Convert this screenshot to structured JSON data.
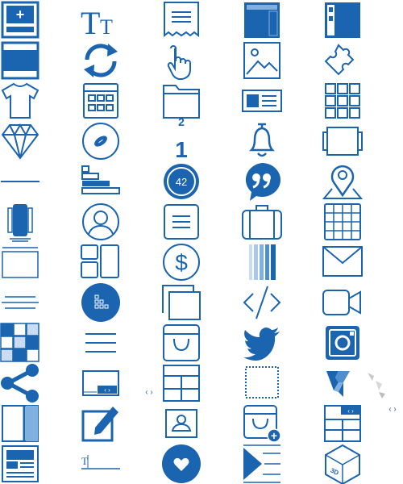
{
  "colors": {
    "primary": "#1a64b0",
    "light": "#7fb0e0",
    "pale": "#c9dcf1",
    "grey": "#c8c8c8",
    "white": "#ffffff"
  },
  "icons": {
    "add_block": {
      "name": "add-block-icon",
      "glyph": "+"
    },
    "typography": {
      "name": "typography-icon",
      "glyph_large": "T",
      "glyph_small": "T"
    },
    "receipt": {
      "name": "receipt-icon"
    },
    "header_layout": {
      "name": "header-layout-icon"
    },
    "sidebar_layout": {
      "name": "sidebar-layout-icon"
    },
    "banner": {
      "name": "banner-icon"
    },
    "refresh": {
      "name": "refresh-icon"
    },
    "tap": {
      "name": "tap-gesture-icon"
    },
    "image": {
      "name": "image-icon"
    },
    "puzzle": {
      "name": "puzzle-piece-icon"
    },
    "shirt": {
      "name": "tshirt-icon"
    },
    "calendar": {
      "name": "calendar-icon"
    },
    "folder": {
      "name": "folder-icon"
    },
    "media_text": {
      "name": "media-text-icon"
    },
    "grid_3x3": {
      "name": "grid-3x3-icon"
    },
    "diamond": {
      "name": "diamond-icon"
    },
    "football": {
      "name": "football-icon"
    },
    "counter": {
      "name": "counter-icon",
      "top": "2",
      "bottom": "1"
    },
    "bell": {
      "name": "bell-icon"
    },
    "slider": {
      "name": "slider-icon"
    },
    "divider": {
      "name": "divider-icon"
    },
    "progress_bars": {
      "name": "progress-bars-icon"
    },
    "badge": {
      "name": "number-badge-icon",
      "value": "42"
    },
    "quote": {
      "name": "quote-bubble-icon"
    },
    "map_pin": {
      "name": "map-pin-icon"
    },
    "vertical_card": {
      "name": "vertical-card-icon"
    },
    "avatar": {
      "name": "avatar-icon"
    },
    "text_box": {
      "name": "text-box-icon"
    },
    "briefcase": {
      "name": "briefcase-icon"
    },
    "table_grid": {
      "name": "table-grid-icon"
    },
    "empty_box": {
      "name": "empty-box-icon"
    },
    "tiles": {
      "name": "tiles-icon"
    },
    "dollar": {
      "name": "dollar-icon",
      "glyph": "$"
    },
    "color_bars": {
      "name": "color-bars-icon"
    },
    "envelope": {
      "name": "envelope-icon"
    },
    "spacer": {
      "name": "spacer-icon"
    },
    "sitemap": {
      "name": "sitemap-icon"
    },
    "stack": {
      "name": "stack-icon"
    },
    "code": {
      "name": "code-icon"
    },
    "video": {
      "name": "video-camera-icon"
    },
    "checker_grid": {
      "name": "checker-grid-icon"
    },
    "menu": {
      "name": "menu-lines-icon"
    },
    "bag": {
      "name": "shopping-bag-icon"
    },
    "twitter": {
      "name": "twitter-icon"
    },
    "instagram": {
      "name": "instagram-icon"
    },
    "share": {
      "name": "share-icon"
    },
    "carousel": {
      "name": "carousel-icon",
      "arrows": "‹ ›"
    },
    "arrows_left": {
      "name": "arrows-icon",
      "glyph": "‹ ›"
    },
    "mega_menu": {
      "name": "mega-menu-icon"
    },
    "dashed_box": {
      "name": "dashed-box-icon"
    },
    "vertex": {
      "name": "vertex-logo-icon"
    },
    "vertex_grey": {
      "name": "vertex-grey-icon"
    },
    "arrows_right": {
      "name": "arrows-icon",
      "glyph": "‹ ›"
    },
    "split": {
      "name": "split-layout-icon"
    },
    "edit": {
      "name": "edit-icon"
    },
    "contact_card": {
      "name": "contact-card-icon"
    },
    "add_to_bag": {
      "name": "add-to-bag-icon",
      "glyph": "+"
    },
    "slider_layout": {
      "name": "slider-layout-icon",
      "arrows": "‹ ›"
    },
    "post_card": {
      "name": "post-card-icon"
    },
    "text_field": {
      "name": "text-field-icon",
      "glyph": "T"
    },
    "heart": {
      "name": "heart-icon"
    },
    "play_list": {
      "name": "play-list-icon"
    },
    "box_3d": {
      "name": "3d-box-icon",
      "label": "3D"
    }
  }
}
